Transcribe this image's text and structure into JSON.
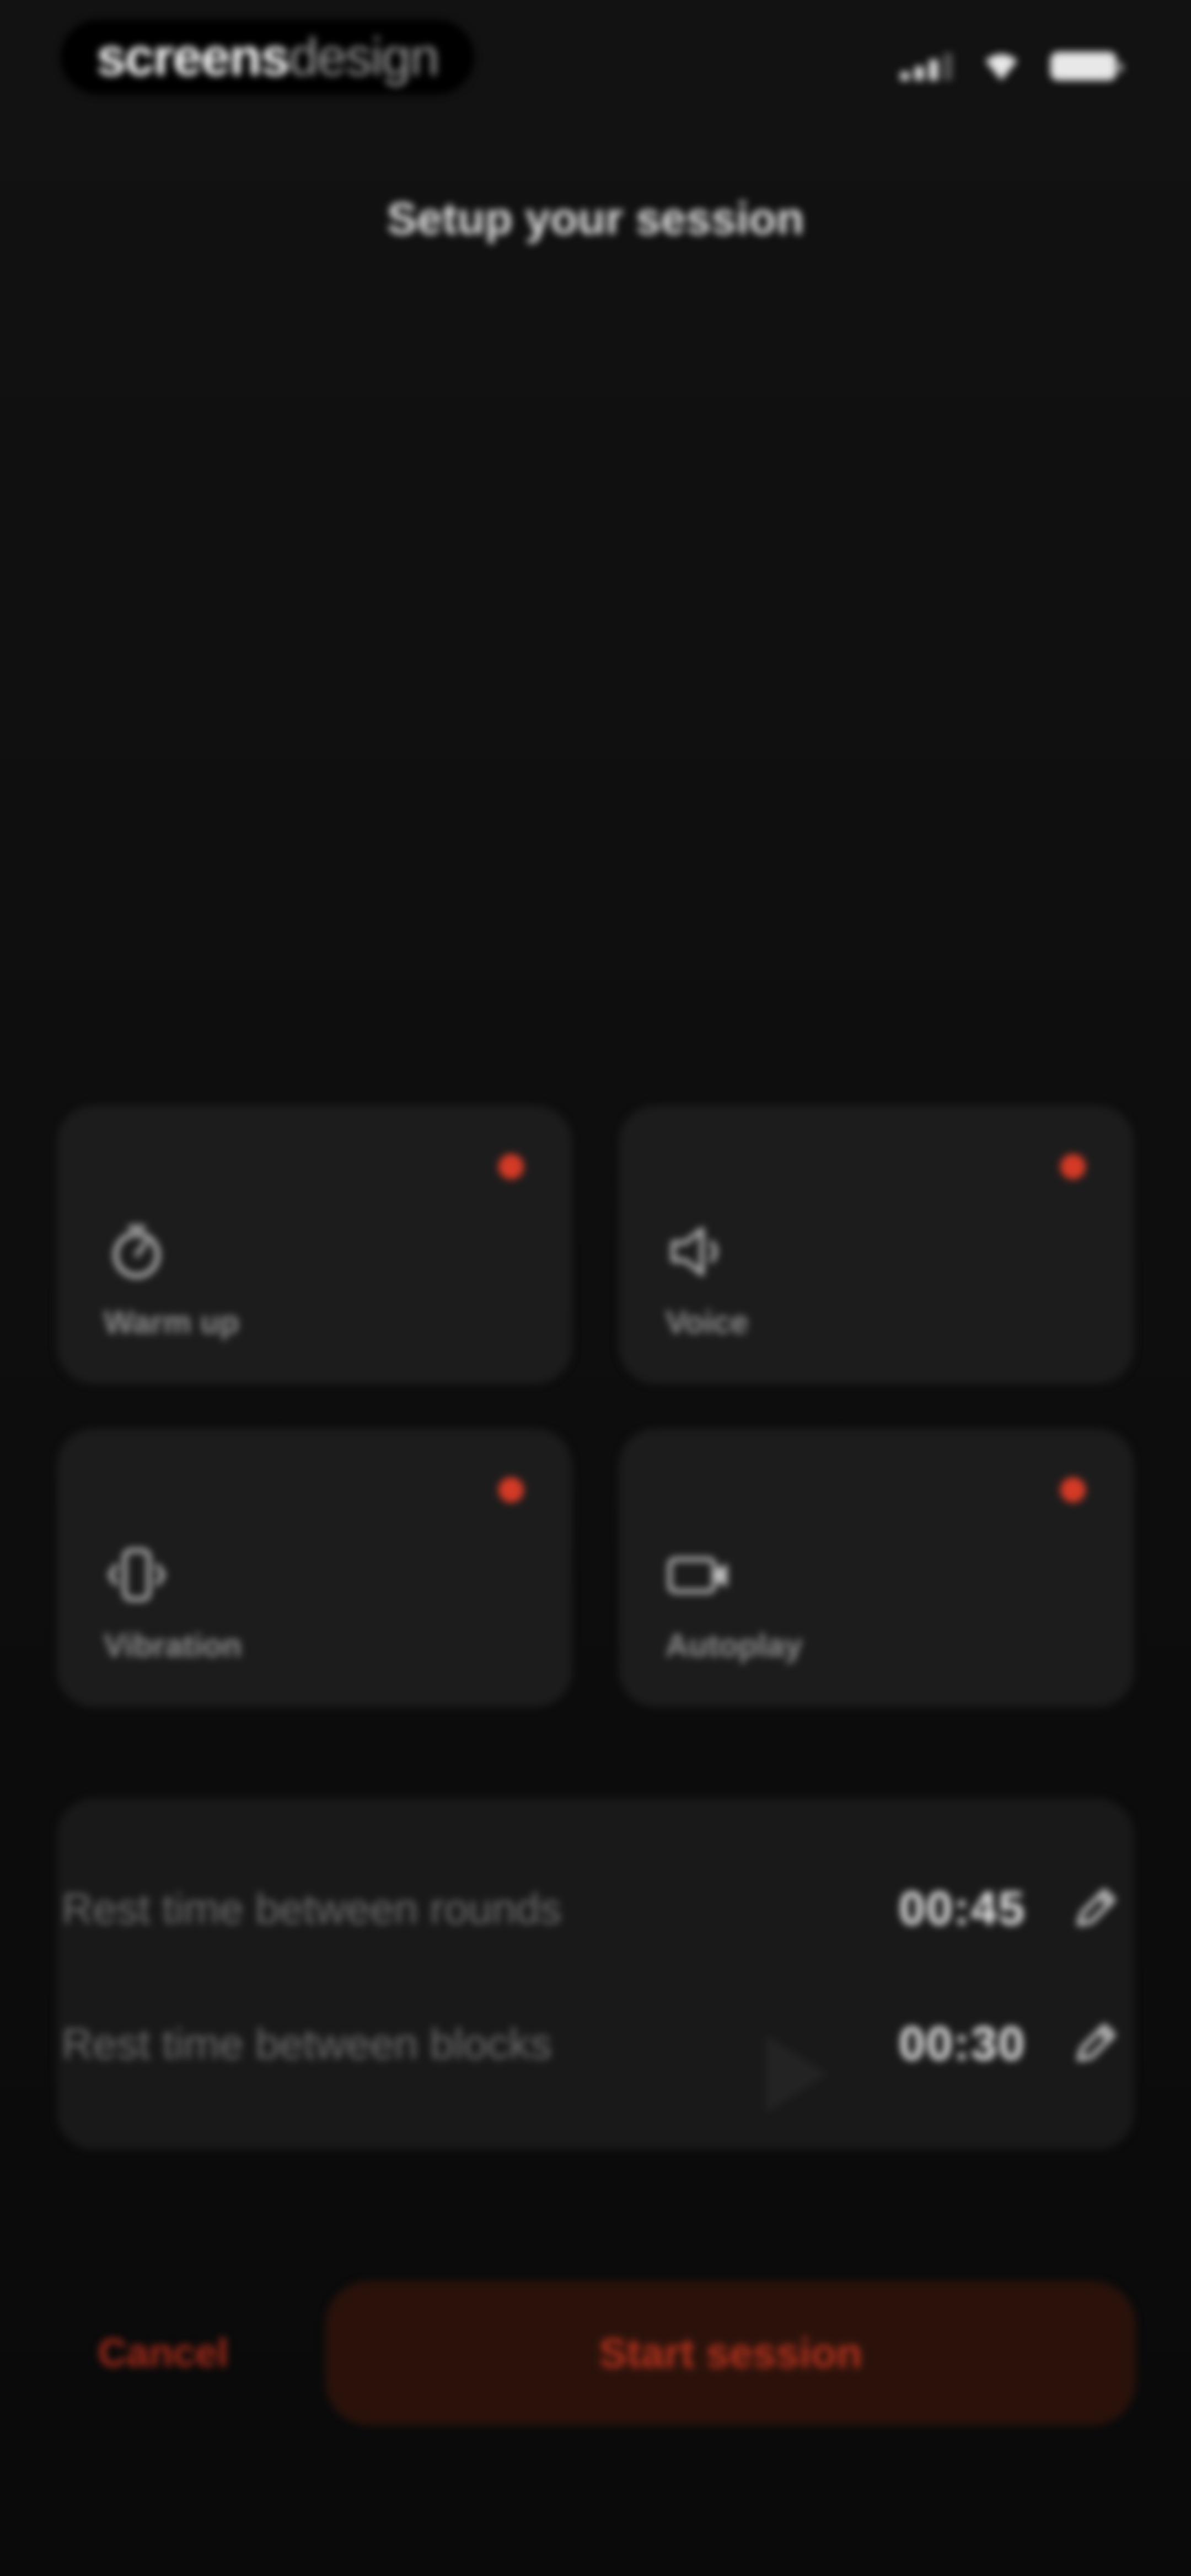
{
  "status_bar": {
    "brand_bold": "screens",
    "brand_light": "design",
    "signal_icon": "cellular-signal-icon",
    "wifi_icon": "wifi-icon",
    "battery_icon": "battery-icon"
  },
  "header": {
    "title": "Setup your session"
  },
  "options": [
    {
      "label": "Warm up",
      "icon": "stopwatch-icon",
      "active": true
    },
    {
      "label": "Voice",
      "icon": "speaker-icon",
      "active": true
    },
    {
      "label": "Vibration",
      "icon": "vibration-icon",
      "active": true
    },
    {
      "label": "Autoplay",
      "icon": "video-icon",
      "active": true
    }
  ],
  "rest_times": [
    {
      "label": "Rest time between rounds",
      "value": "00:45",
      "edit_icon": "pencil-icon"
    },
    {
      "label": "Rest time between blocks",
      "value": "00:30",
      "edit_icon": "pencil-icon"
    }
  ],
  "actions": {
    "cancel_label": "Cancel",
    "start_label": "Start session"
  },
  "colors": {
    "accent": "#d43a26",
    "background": "#0e0e0e",
    "tile": "#1c1c1c"
  }
}
